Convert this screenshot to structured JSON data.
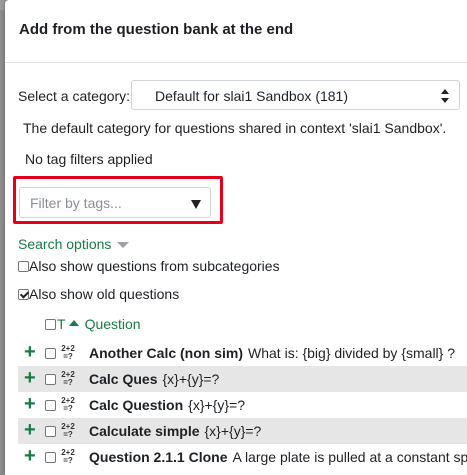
{
  "dialog": {
    "title": "Add from the question bank at the end"
  },
  "category": {
    "label": "Select a category:",
    "selected": "Default for slai1 Sandbox (181)",
    "description": "The default category for questions shared in context 'slai1 Sandbox'."
  },
  "tags": {
    "status": "No tag filters applied",
    "placeholder": "Filter by tags..."
  },
  "search_options": {
    "label": "Search options",
    "subcategories_label": "Also show questions from subcategories",
    "subcategories_checked": false,
    "old_questions_label": "Also show old questions",
    "old_questions_checked": true
  },
  "table": {
    "type_header": "T",
    "question_header": "Question",
    "rows": [
      {
        "name": "Another Calc (non sim)",
        "text": "What is: {big} divided by {small} ?"
      },
      {
        "name": "Calc Ques",
        "text": "{x}+{y}=?"
      },
      {
        "name": "Calc Question",
        "text": "{x}+{y}=?"
      },
      {
        "name": "Calculate simple",
        "text": "{x}+{y}=?"
      },
      {
        "name": "Question 2.1.1 Clone",
        "text": "A large plate is pulled at a constant sp"
      }
    ],
    "type_icon_top": "2+2",
    "type_icon_bottom": "=?"
  },
  "colors": {
    "accent_green": "#1a7a44",
    "highlight_red": "#e3001b"
  }
}
